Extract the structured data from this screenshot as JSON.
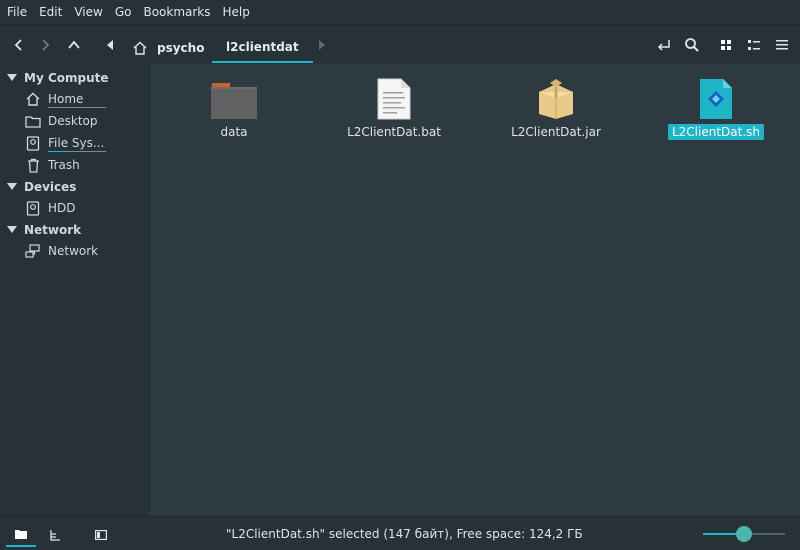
{
  "menu": [
    "File",
    "Edit",
    "View",
    "Go",
    "Bookmarks",
    "Help"
  ],
  "breadcrumb": {
    "home": "psycho",
    "current": "l2clientdat"
  },
  "sidebar": {
    "sections": [
      {
        "title": "My Compute",
        "items": [
          {
            "label": "Home",
            "icon": "home-icon"
          },
          {
            "label": "Desktop",
            "icon": "folder-icon"
          },
          {
            "label": "File Sys...",
            "icon": "drive-icon"
          },
          {
            "label": "Trash",
            "icon": "trash-icon"
          }
        ]
      },
      {
        "title": "Devices",
        "items": [
          {
            "label": "HDD",
            "icon": "drive-icon"
          }
        ]
      },
      {
        "title": "Network",
        "items": [
          {
            "label": "Network",
            "icon": "network-icon"
          }
        ]
      }
    ]
  },
  "files": [
    {
      "name": "data",
      "icon": "folder-icon",
      "selected": false
    },
    {
      "name": "L2ClientDat.bat",
      "icon": "text-file-icon",
      "selected": false
    },
    {
      "name": "L2ClientDat.jar",
      "icon": "archive-icon",
      "selected": false
    },
    {
      "name": "L2ClientDat.sh",
      "icon": "script-icon",
      "selected": true
    }
  ],
  "status": {
    "text": "\"L2ClientDat.sh\" selected (147 байт), Free space: 124,2 ГБ"
  },
  "zoom": {
    "level": 0.5
  },
  "colors": {
    "accent": "#1fb5c8",
    "background": "#263238",
    "content": "#2d3a40"
  }
}
